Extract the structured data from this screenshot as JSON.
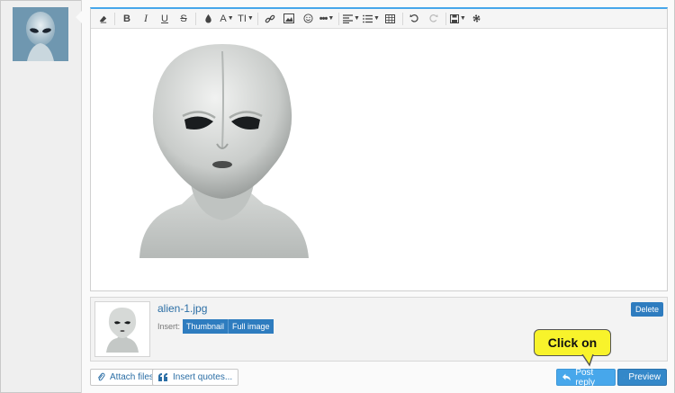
{
  "toolbar": {
    "buttons": [
      {
        "icon": "eraser-icon"
      },
      {
        "icon": "bold-icon",
        "label": "B"
      },
      {
        "icon": "italic-icon",
        "label": "I"
      },
      {
        "icon": "underline-icon",
        "label": "U"
      },
      {
        "icon": "strikethrough-icon",
        "label": "S"
      },
      {
        "icon": "color-drop-icon"
      },
      {
        "icon": "font-family-icon",
        "label": "A"
      },
      {
        "icon": "font-size-icon",
        "label": "TI"
      },
      {
        "icon": "link-icon"
      },
      {
        "icon": "image-icon"
      },
      {
        "icon": "smiley-icon"
      },
      {
        "icon": "more-icon"
      },
      {
        "icon": "align-icon"
      },
      {
        "icon": "list-icon"
      },
      {
        "icon": "table-icon"
      },
      {
        "icon": "undo-icon"
      },
      {
        "icon": "redo-icon"
      },
      {
        "icon": "save-draft-icon"
      },
      {
        "icon": "gear-icon"
      }
    ]
  },
  "attachment": {
    "filename": "alien-1.jpg",
    "insert_label": "Insert:",
    "thumbnail_label": "Thumbnail",
    "full_image_label": "Full image",
    "delete_label": "Delete"
  },
  "actions": {
    "attach_files_label": "Attach files",
    "insert_quotes_label": "Insert quotes...",
    "post_reply_label": "Post reply",
    "preview_label": "Preview"
  },
  "callout": {
    "text": "Click on"
  },
  "colors": {
    "accent": "#47a7eb",
    "button_blue": "#2e7cbf",
    "callout_yellow": "#f8f32b"
  }
}
